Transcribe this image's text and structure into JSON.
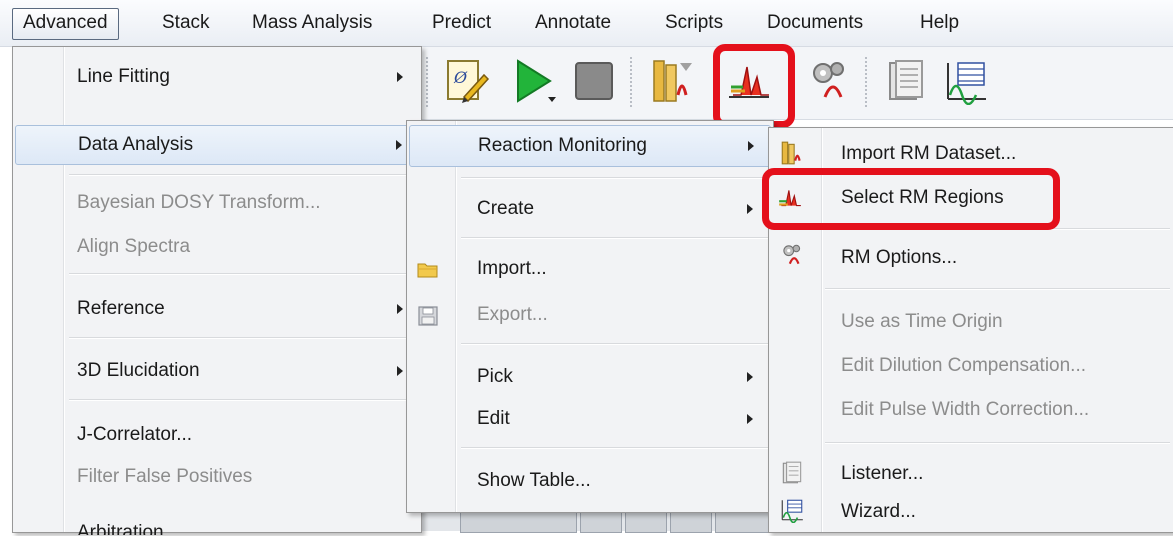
{
  "menubar": {
    "items": [
      "Advanced",
      "Stack",
      "Mass Analysis",
      "Predict",
      "Annotate",
      "Scripts",
      "Documents",
      "Help"
    ],
    "active": "Advanced"
  },
  "toolbar": {
    "icons": [
      "script-edit-icon",
      "run-icon",
      "stop-icon",
      "import-rm-dataset-icon",
      "select-rm-regions-icon",
      "rm-options-icon",
      "listener-icon",
      "wizard-icon"
    ],
    "highlighted": "select-rm-regions-icon"
  },
  "advanced_menu": {
    "items": [
      {
        "label": "Line Fitting",
        "submenu": true,
        "enabled": true
      },
      {
        "label": "Data Analysis",
        "submenu": true,
        "enabled": true,
        "highlighted": true
      },
      {
        "label": "Bayesian DOSY Transform...",
        "submenu": false,
        "enabled": false
      },
      {
        "label": "Align Spectra",
        "submenu": false,
        "enabled": false
      },
      {
        "label": "Reference",
        "submenu": true,
        "enabled": true
      },
      {
        "label": "3D Elucidation",
        "submenu": true,
        "enabled": true
      },
      {
        "label": "J-Correlator...",
        "submenu": false,
        "enabled": true
      },
      {
        "label": "Filter False Positives",
        "submenu": false,
        "enabled": false
      },
      {
        "label": "Arbitration",
        "submenu": false,
        "enabled": true
      }
    ]
  },
  "data_analysis_menu": {
    "items": [
      {
        "label": "Reaction Monitoring",
        "submenu": true,
        "enabled": true,
        "highlighted": true
      },
      {
        "label": "Create",
        "submenu": true,
        "enabled": true
      },
      {
        "label": "Import...",
        "submenu": false,
        "enabled": true,
        "icon": "folder-icon"
      },
      {
        "label": "Export...",
        "submenu": false,
        "enabled": false,
        "icon": "save-icon"
      },
      {
        "label": "Pick",
        "submenu": true,
        "enabled": true
      },
      {
        "label": "Edit",
        "submenu": true,
        "enabled": true
      },
      {
        "label": "Show Table...",
        "submenu": false,
        "enabled": true
      }
    ]
  },
  "reaction_monitoring_menu": {
    "items": [
      {
        "label": "Import RM Dataset...",
        "enabled": true,
        "icon": "import-rm-dataset-icon"
      },
      {
        "label": "Select RM Regions",
        "enabled": true,
        "icon": "select-rm-regions-icon",
        "highlighted_box": true
      },
      {
        "label": "RM Options...",
        "enabled": true,
        "icon": "rm-options-icon"
      },
      {
        "label": "Use as Time Origin",
        "enabled": false
      },
      {
        "label": "Edit Dilution Compensation...",
        "enabled": false
      },
      {
        "label": "Edit Pulse Width Correction...",
        "enabled": false
      },
      {
        "label": "Listener...",
        "enabled": true,
        "icon": "listener-icon"
      },
      {
        "label": "Wizard...",
        "enabled": true,
        "icon": "wizard-icon"
      }
    ]
  },
  "colors": {
    "highlight_box": "#e4101b",
    "menu_bg": "#f2f3f5",
    "hover_bg": "#dde8f6",
    "disabled_text": "#8c8c8c"
  }
}
